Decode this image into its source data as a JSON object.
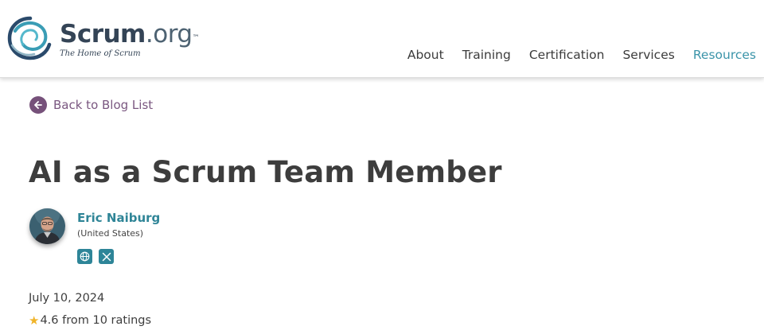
{
  "header": {
    "logo": {
      "word_bold": "Scrum",
      "word_light": ".org",
      "trademark": "™",
      "tagline": "The Home of Scrum",
      "icon": "scrum-swirl-logo"
    },
    "nav": [
      {
        "label": "About",
        "active": false
      },
      {
        "label": "Training",
        "active": false
      },
      {
        "label": "Certification",
        "active": false
      },
      {
        "label": "Services",
        "active": false
      },
      {
        "label": "Resources",
        "active": true
      }
    ]
  },
  "back_link": {
    "label": "Back to Blog List",
    "icon": "arrow-left-icon"
  },
  "article": {
    "title": "AI as a Scrum Team Member",
    "author": {
      "name": "Eric Naiburg",
      "country": "(United States)",
      "avatar": "author-photo",
      "social": [
        {
          "icon": "globe-icon"
        },
        {
          "icon": "x-icon"
        }
      ]
    },
    "date": "July 10, 2024",
    "rating": {
      "star": "★",
      "text": "4.6 from 10 ratings"
    }
  },
  "colors": {
    "nav_active": "#3b94a9",
    "back_accent": "#76517a",
    "author_link": "#2f8597",
    "star": "#f0b429"
  }
}
